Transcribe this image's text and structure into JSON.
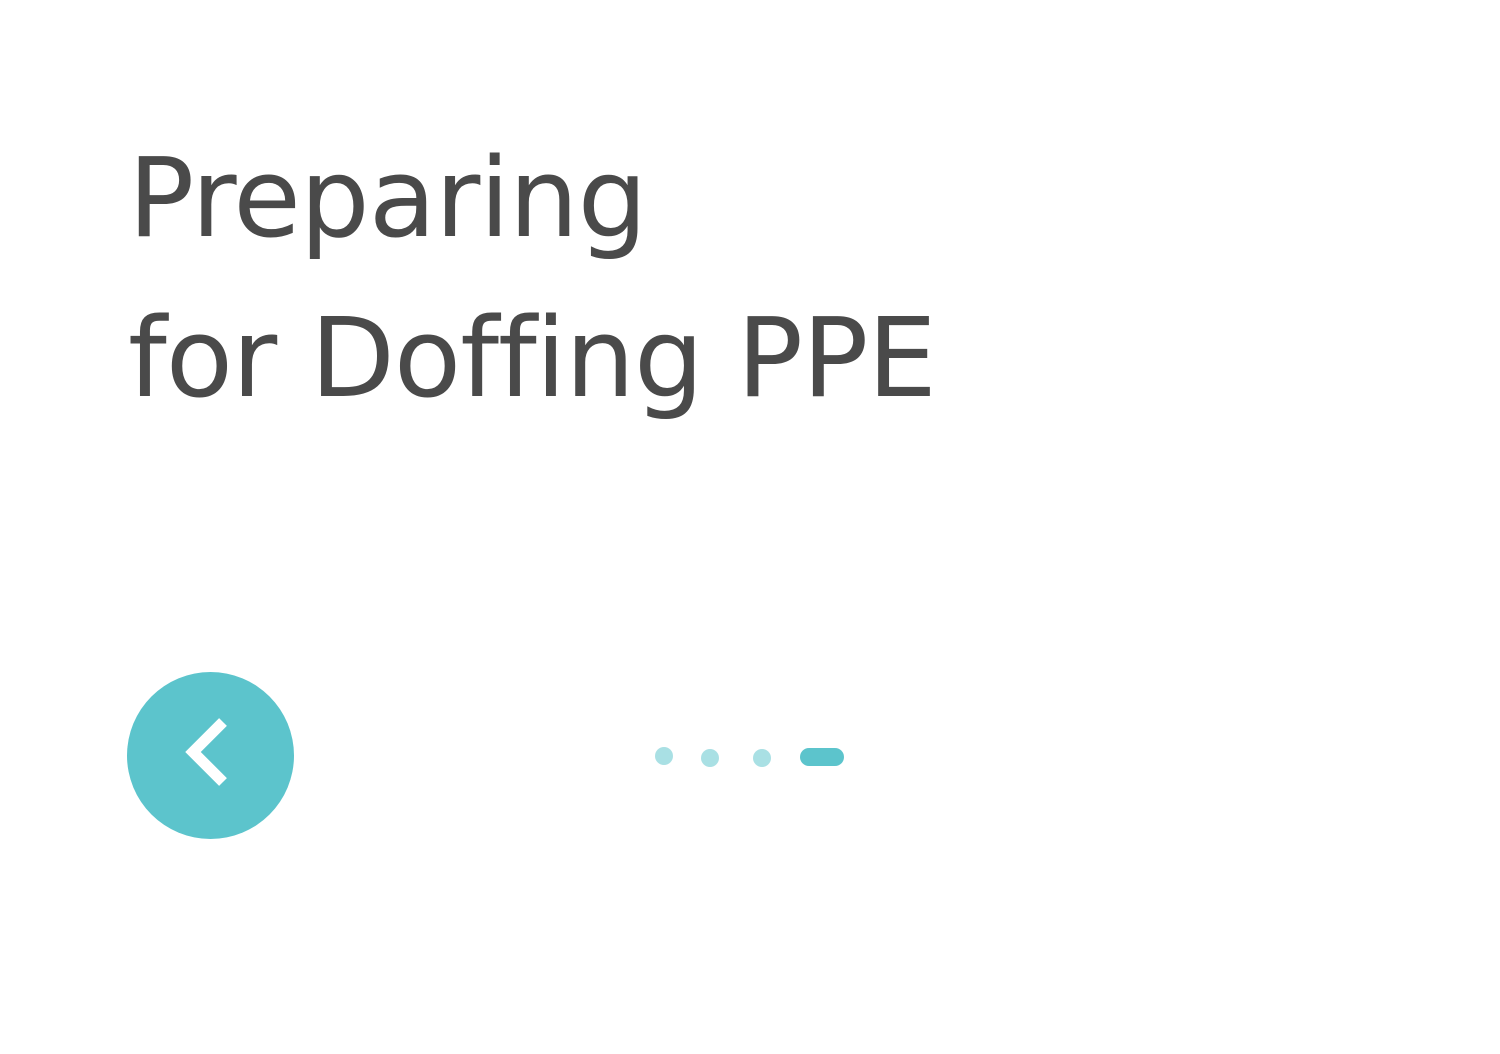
{
  "title": {
    "line1": "Preparing",
    "line2": "for Doffing PPE"
  },
  "nav": {
    "back_icon": "chevron-left-icon"
  },
  "pager": {
    "total": 4,
    "current": 4
  },
  "colors": {
    "accent": "#5cc4cc",
    "dot_inactive": "#a9e0e4",
    "text": "#4a4a4a",
    "background": "#ffffff"
  }
}
